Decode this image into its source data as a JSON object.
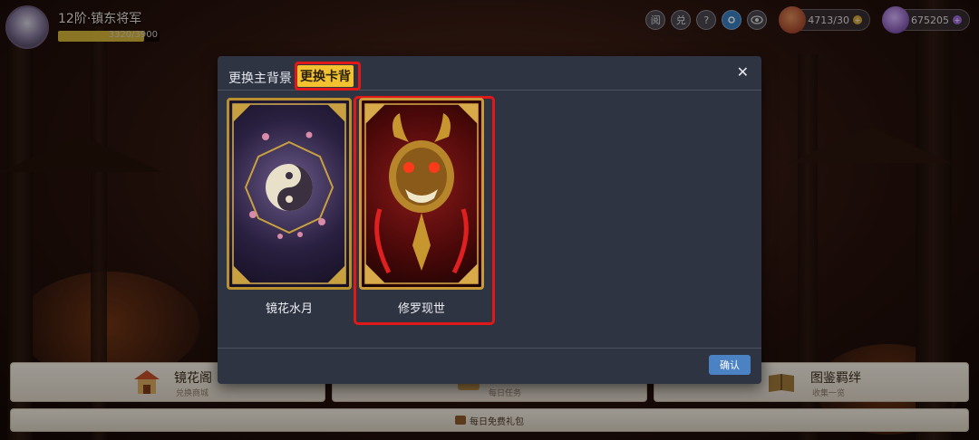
{
  "header": {
    "rank_title": "12阶·镇东将军",
    "exp_text": "3320/3900",
    "exp_ratio": 0.851
  },
  "hud": {
    "buttons": [
      "阅",
      "兑",
      "?"
    ],
    "currency_gold": "4713/30",
    "currency_gem": "675205"
  },
  "bottom_menu": {
    "mirror_title": "镜花阁",
    "mirror_sub": "兑换商城",
    "task_sub": "每日任务",
    "atlas_title": "图鉴羁绊",
    "atlas_sub": "收集一览",
    "daily_gift": "每日免费礼包"
  },
  "dialog": {
    "tabs": [
      {
        "label": "更换主背景",
        "active": false
      },
      {
        "label": "更换卡背",
        "active": true
      }
    ],
    "close_label": "✕",
    "cards": [
      {
        "name": "镜花水月",
        "selected": false
      },
      {
        "name": "修罗现世",
        "selected": true
      }
    ],
    "confirm_label": "确认"
  },
  "colors": {
    "dialog_bg": "#2e3442",
    "active_tab": "#f2c230",
    "highlight": "#e01818",
    "confirm": "#4a82c4"
  }
}
